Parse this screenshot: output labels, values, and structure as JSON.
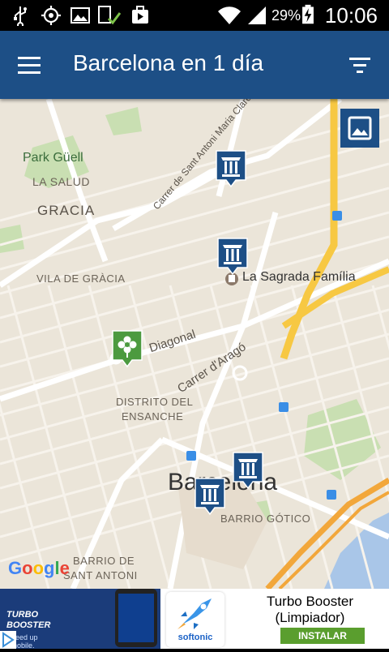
{
  "status_bar": {
    "battery_percent": "29%",
    "time": "10:06",
    "icons": [
      "usb-icon",
      "gps-icon",
      "image-icon",
      "device-check-icon",
      "briefcase-play-icon",
      "wifi-icon",
      "signal-icon",
      "battery-charging-icon"
    ]
  },
  "app_bar": {
    "title": "Barcelona en 1 día",
    "menu_icon": "hamburger-menu-icon",
    "filter_icon": "filter-icon",
    "color": "#1d4f86"
  },
  "map": {
    "labels": {
      "park_guell": "Park Güell",
      "la_salud": "LA SALUD",
      "gracia": "GRACIA",
      "vila_de_gracia": "VILA DE GRÀCIA",
      "street_claret": "Carrer de Sant Antoni Maria Claret",
      "sagrada_familia": "La Sagrada Família",
      "diagonal": "Diagonal",
      "carrer_arago": "Carrer d'Aragó",
      "distrito_line1": "DISTRITO DEL",
      "distrito_line2": "ENSANCHE",
      "barcelona": "Barcelona",
      "barrio_gotico": "BARRIO GÓTICO",
      "barrio_sant_antoni_line1": "BARRIO DE",
      "barrio_sant_antoni_line2": "SANT ANTONI"
    },
    "google_logo": "Google",
    "layers_button_icon": "image-layers-icon",
    "markers": [
      {
        "name": "monument-marker-1",
        "icon": "column-monument-icon",
        "color": "#1d4f86"
      },
      {
        "name": "monument-marker-2",
        "icon": "column-monument-icon",
        "color": "#1d4f86"
      },
      {
        "name": "park-marker",
        "icon": "flower-icon",
        "color": "#4c9a3f"
      },
      {
        "name": "monument-marker-3",
        "icon": "column-monument-icon",
        "color": "#1d4f86"
      },
      {
        "name": "monument-marker-4",
        "icon": "column-monument-icon",
        "color": "#1d4f86"
      }
    ]
  },
  "ad": {
    "image_title": "TURBO\nBOOSTER",
    "image_sub": "Speed up\nr mobile.",
    "logo_text": "softonic",
    "title": "Turbo Booster (Limpiador)",
    "install_label": "INSTALAR",
    "install_color": "#5a9e2e"
  }
}
